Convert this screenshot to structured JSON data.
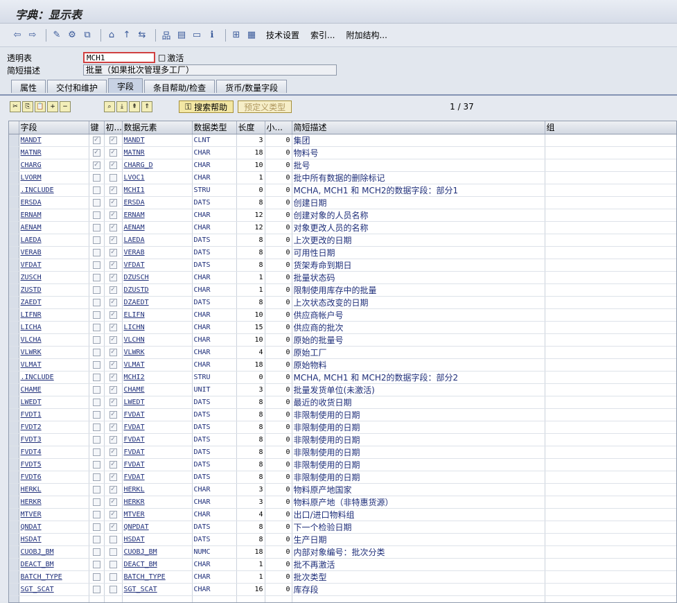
{
  "window": {
    "title": "字典：显示表"
  },
  "toolbar": {
    "tech_settings": "技术设置",
    "index": "索引...",
    "append_struct": "附加结构..."
  },
  "header": {
    "table_label": "透明表",
    "table_value": "MCH1",
    "status": "激活",
    "desc_label": "简短描述",
    "desc_value": "批量（如果批次管理多工厂）"
  },
  "tabs": [
    "属性",
    "交付和维护",
    "字段",
    "条目帮助/检查",
    "货币/数量字段"
  ],
  "gridbar": {
    "search_help": "搜索帮助",
    "predef_type": "预定义类型",
    "pager": "1 / 37"
  },
  "columns": [
    "字段",
    "键",
    "初...",
    "数据元素",
    "数据类型",
    "长度",
    "小...",
    "简短描述",
    "组"
  ],
  "rows": [
    {
      "f": "MANDT",
      "k": true,
      "i": true,
      "de": "MANDT",
      "t": "CLNT",
      "l": "3",
      "d": "0",
      "desc": "集团"
    },
    {
      "f": "MATNR",
      "k": true,
      "i": true,
      "de": "MATNR",
      "t": "CHAR",
      "l": "18",
      "d": "0",
      "desc": "物料号"
    },
    {
      "f": "CHARG",
      "k": true,
      "i": true,
      "de": "CHARG_D",
      "t": "CHAR",
      "l": "10",
      "d": "0",
      "desc": "批号"
    },
    {
      "f": "LVORM",
      "k": false,
      "i": false,
      "de": "LVOC1",
      "t": "CHAR",
      "l": "1",
      "d": "0",
      "desc": "批中所有数据的删除标记"
    },
    {
      "f": ".INCLUDE",
      "k": false,
      "i": true,
      "de": "MCHI1",
      "t": "STRU",
      "l": "0",
      "d": "0",
      "desc": "MCHA, MCH1 和 MCH2的数据字段：部分1"
    },
    {
      "f": "ERSDA",
      "k": false,
      "i": true,
      "de": "ERSDA",
      "t": "DATS",
      "l": "8",
      "d": "0",
      "desc": "创建日期"
    },
    {
      "f": "ERNAM",
      "k": false,
      "i": true,
      "de": "ERNAM",
      "t": "CHAR",
      "l": "12",
      "d": "0",
      "desc": "创建对象的人员名称"
    },
    {
      "f": "AENAM",
      "k": false,
      "i": true,
      "de": "AENAM",
      "t": "CHAR",
      "l": "12",
      "d": "0",
      "desc": "对象更改人员的名称"
    },
    {
      "f": "LAEDA",
      "k": false,
      "i": true,
      "de": "LAEDA",
      "t": "DATS",
      "l": "8",
      "d": "0",
      "desc": "上次更改的日期"
    },
    {
      "f": "VERAB",
      "k": false,
      "i": true,
      "de": "VERAB",
      "t": "DATS",
      "l": "8",
      "d": "0",
      "desc": "可用性日期"
    },
    {
      "f": "VFDAT",
      "k": false,
      "i": true,
      "de": "VFDAT",
      "t": "DATS",
      "l": "8",
      "d": "0",
      "desc": "货架寿命到期日"
    },
    {
      "f": "ZUSCH",
      "k": false,
      "i": true,
      "de": "DZUSCH",
      "t": "CHAR",
      "l": "1",
      "d": "0",
      "desc": "批量状态码"
    },
    {
      "f": "ZUSTD",
      "k": false,
      "i": true,
      "de": "DZUSTD",
      "t": "CHAR",
      "l": "1",
      "d": "0",
      "desc": "限制使用库存中的批量"
    },
    {
      "f": "ZAEDT",
      "k": false,
      "i": true,
      "de": "DZAEDT",
      "t": "DATS",
      "l": "8",
      "d": "0",
      "desc": "上次状态改变的日期"
    },
    {
      "f": "LIFNR",
      "k": false,
      "i": true,
      "de": "ELIFN",
      "t": "CHAR",
      "l": "10",
      "d": "0",
      "desc": "供应商帐户号"
    },
    {
      "f": "LICHA",
      "k": false,
      "i": true,
      "de": "LICHN",
      "t": "CHAR",
      "l": "15",
      "d": "0",
      "desc": "供应商的批次"
    },
    {
      "f": "VLCHA",
      "k": false,
      "i": true,
      "de": "VLCHN",
      "t": "CHAR",
      "l": "10",
      "d": "0",
      "desc": "原始的批量号"
    },
    {
      "f": "VLWRK",
      "k": false,
      "i": true,
      "de": "VLWRK",
      "t": "CHAR",
      "l": "4",
      "d": "0",
      "desc": "原始工厂"
    },
    {
      "f": "VLMAT",
      "k": false,
      "i": true,
      "de": "VLMAT",
      "t": "CHAR",
      "l": "18",
      "d": "0",
      "desc": "原始物料"
    },
    {
      "f": ".INCLUDE",
      "k": false,
      "i": true,
      "de": "MCHI2",
      "t": "STRU",
      "l": "0",
      "d": "0",
      "desc": "MCHA, MCH1 和 MCH2的数据字段：部分2"
    },
    {
      "f": "CHAME",
      "k": false,
      "i": true,
      "de": "CHAME",
      "t": "UNIT",
      "l": "3",
      "d": "0",
      "desc": "批量发货单位(未激活)"
    },
    {
      "f": "LWEDT",
      "k": false,
      "i": true,
      "de": "LWEDT",
      "t": "DATS",
      "l": "8",
      "d": "0",
      "desc": "最近的收货日期"
    },
    {
      "f": "FVDT1",
      "k": false,
      "i": true,
      "de": "FVDAT",
      "t": "DATS",
      "l": "8",
      "d": "0",
      "desc": "非限制使用的日期"
    },
    {
      "f": "FVDT2",
      "k": false,
      "i": true,
      "de": "FVDAT",
      "t": "DATS",
      "l": "8",
      "d": "0",
      "desc": "非限制使用的日期"
    },
    {
      "f": "FVDT3",
      "k": false,
      "i": true,
      "de": "FVDAT",
      "t": "DATS",
      "l": "8",
      "d": "0",
      "desc": "非限制使用的日期"
    },
    {
      "f": "FVDT4",
      "k": false,
      "i": true,
      "de": "FVDAT",
      "t": "DATS",
      "l": "8",
      "d": "0",
      "desc": "非限制使用的日期"
    },
    {
      "f": "FVDT5",
      "k": false,
      "i": true,
      "de": "FVDAT",
      "t": "DATS",
      "l": "8",
      "d": "0",
      "desc": "非限制使用的日期"
    },
    {
      "f": "FVDT6",
      "k": false,
      "i": true,
      "de": "FVDAT",
      "t": "DATS",
      "l": "8",
      "d": "0",
      "desc": "非限制使用的日期"
    },
    {
      "f": "HERKL",
      "k": false,
      "i": true,
      "de": "HERKL",
      "t": "CHAR",
      "l": "3",
      "d": "0",
      "desc": "物料原产地国家"
    },
    {
      "f": "HERKR",
      "k": false,
      "i": true,
      "de": "HERKR",
      "t": "CHAR",
      "l": "3",
      "d": "0",
      "desc": "物料原产地（非特惠货源）"
    },
    {
      "f": "MTVER",
      "k": false,
      "i": true,
      "de": "MTVER",
      "t": "CHAR",
      "l": "4",
      "d": "0",
      "desc": "出口/进口物料组"
    },
    {
      "f": "QNDAT",
      "k": false,
      "i": true,
      "de": "QNPDAT",
      "t": "DATS",
      "l": "8",
      "d": "0",
      "desc": "下一个检验日期"
    },
    {
      "f": "HSDAT",
      "k": false,
      "i": false,
      "de": "HSDAT",
      "t": "DATS",
      "l": "8",
      "d": "0",
      "desc": "生产日期"
    },
    {
      "f": "CUOBJ_BM",
      "k": false,
      "i": false,
      "de": "CUOBJ_BM",
      "t": "NUMC",
      "l": "18",
      "d": "0",
      "desc": "内部对象编号：批次分类"
    },
    {
      "f": "DEACT_BM",
      "k": false,
      "i": false,
      "de": "DEACT_BM",
      "t": "CHAR",
      "l": "1",
      "d": "0",
      "desc": "批不再激活"
    },
    {
      "f": "BATCH_TYPE",
      "k": false,
      "i": false,
      "de": "BATCH_TYPE",
      "t": "CHAR",
      "l": "1",
      "d": "0",
      "desc": "批次类型"
    },
    {
      "f": "SGT_SCAT",
      "k": false,
      "i": false,
      "de": "SGT_SCAT",
      "t": "CHAR",
      "l": "16",
      "d": "0",
      "desc": "库存段"
    }
  ]
}
